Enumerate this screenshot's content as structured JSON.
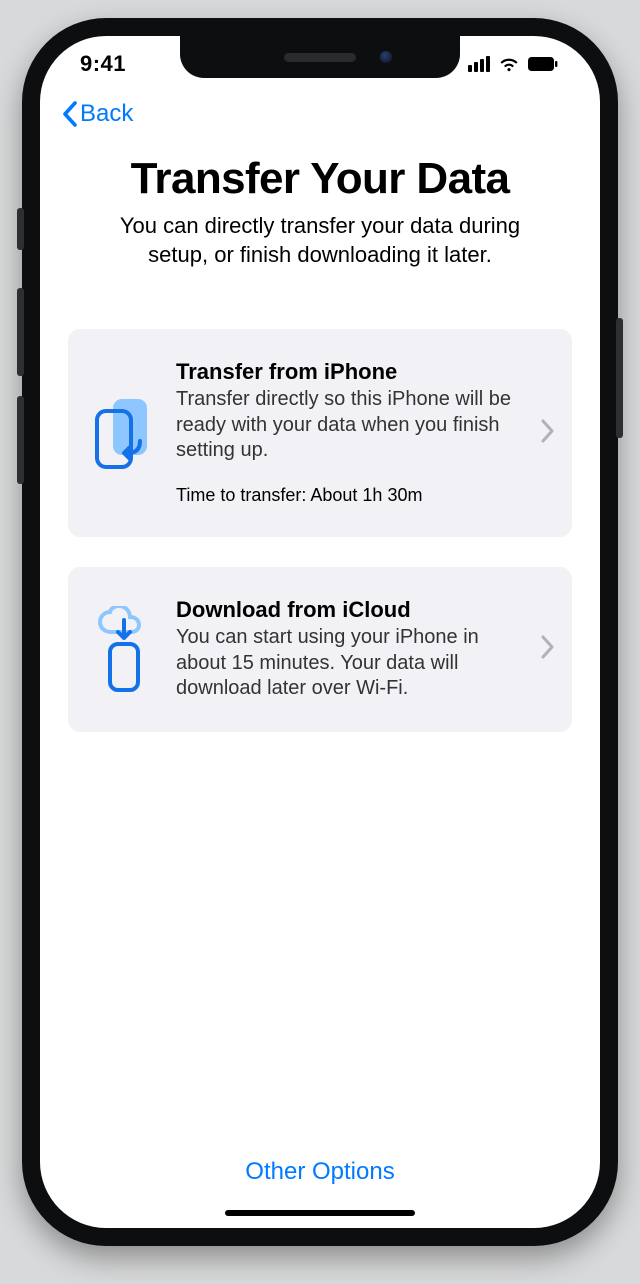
{
  "status": {
    "time": "9:41"
  },
  "nav": {
    "back_label": "Back"
  },
  "page": {
    "title": "Transfer Your Data",
    "subtitle": "You can directly transfer your data during setup, or finish downloading it later."
  },
  "options": [
    {
      "title": "Transfer from iPhone",
      "body": "Transfer directly so this iPhone will be ready with your data when you finish setting up.",
      "eta": "Time to transfer: About 1h 30m"
    },
    {
      "title": "Download from iCloud",
      "body": "You can start using your iPhone in about 15 minutes. Your data will download later over Wi-Fi."
    }
  ],
  "footer": {
    "other_label": "Other Options"
  },
  "colors": {
    "tint": "#007aff",
    "card_bg": "#f2f2f6",
    "icon_lt": "#7ec0ff",
    "icon_dr": "#1571e8"
  }
}
